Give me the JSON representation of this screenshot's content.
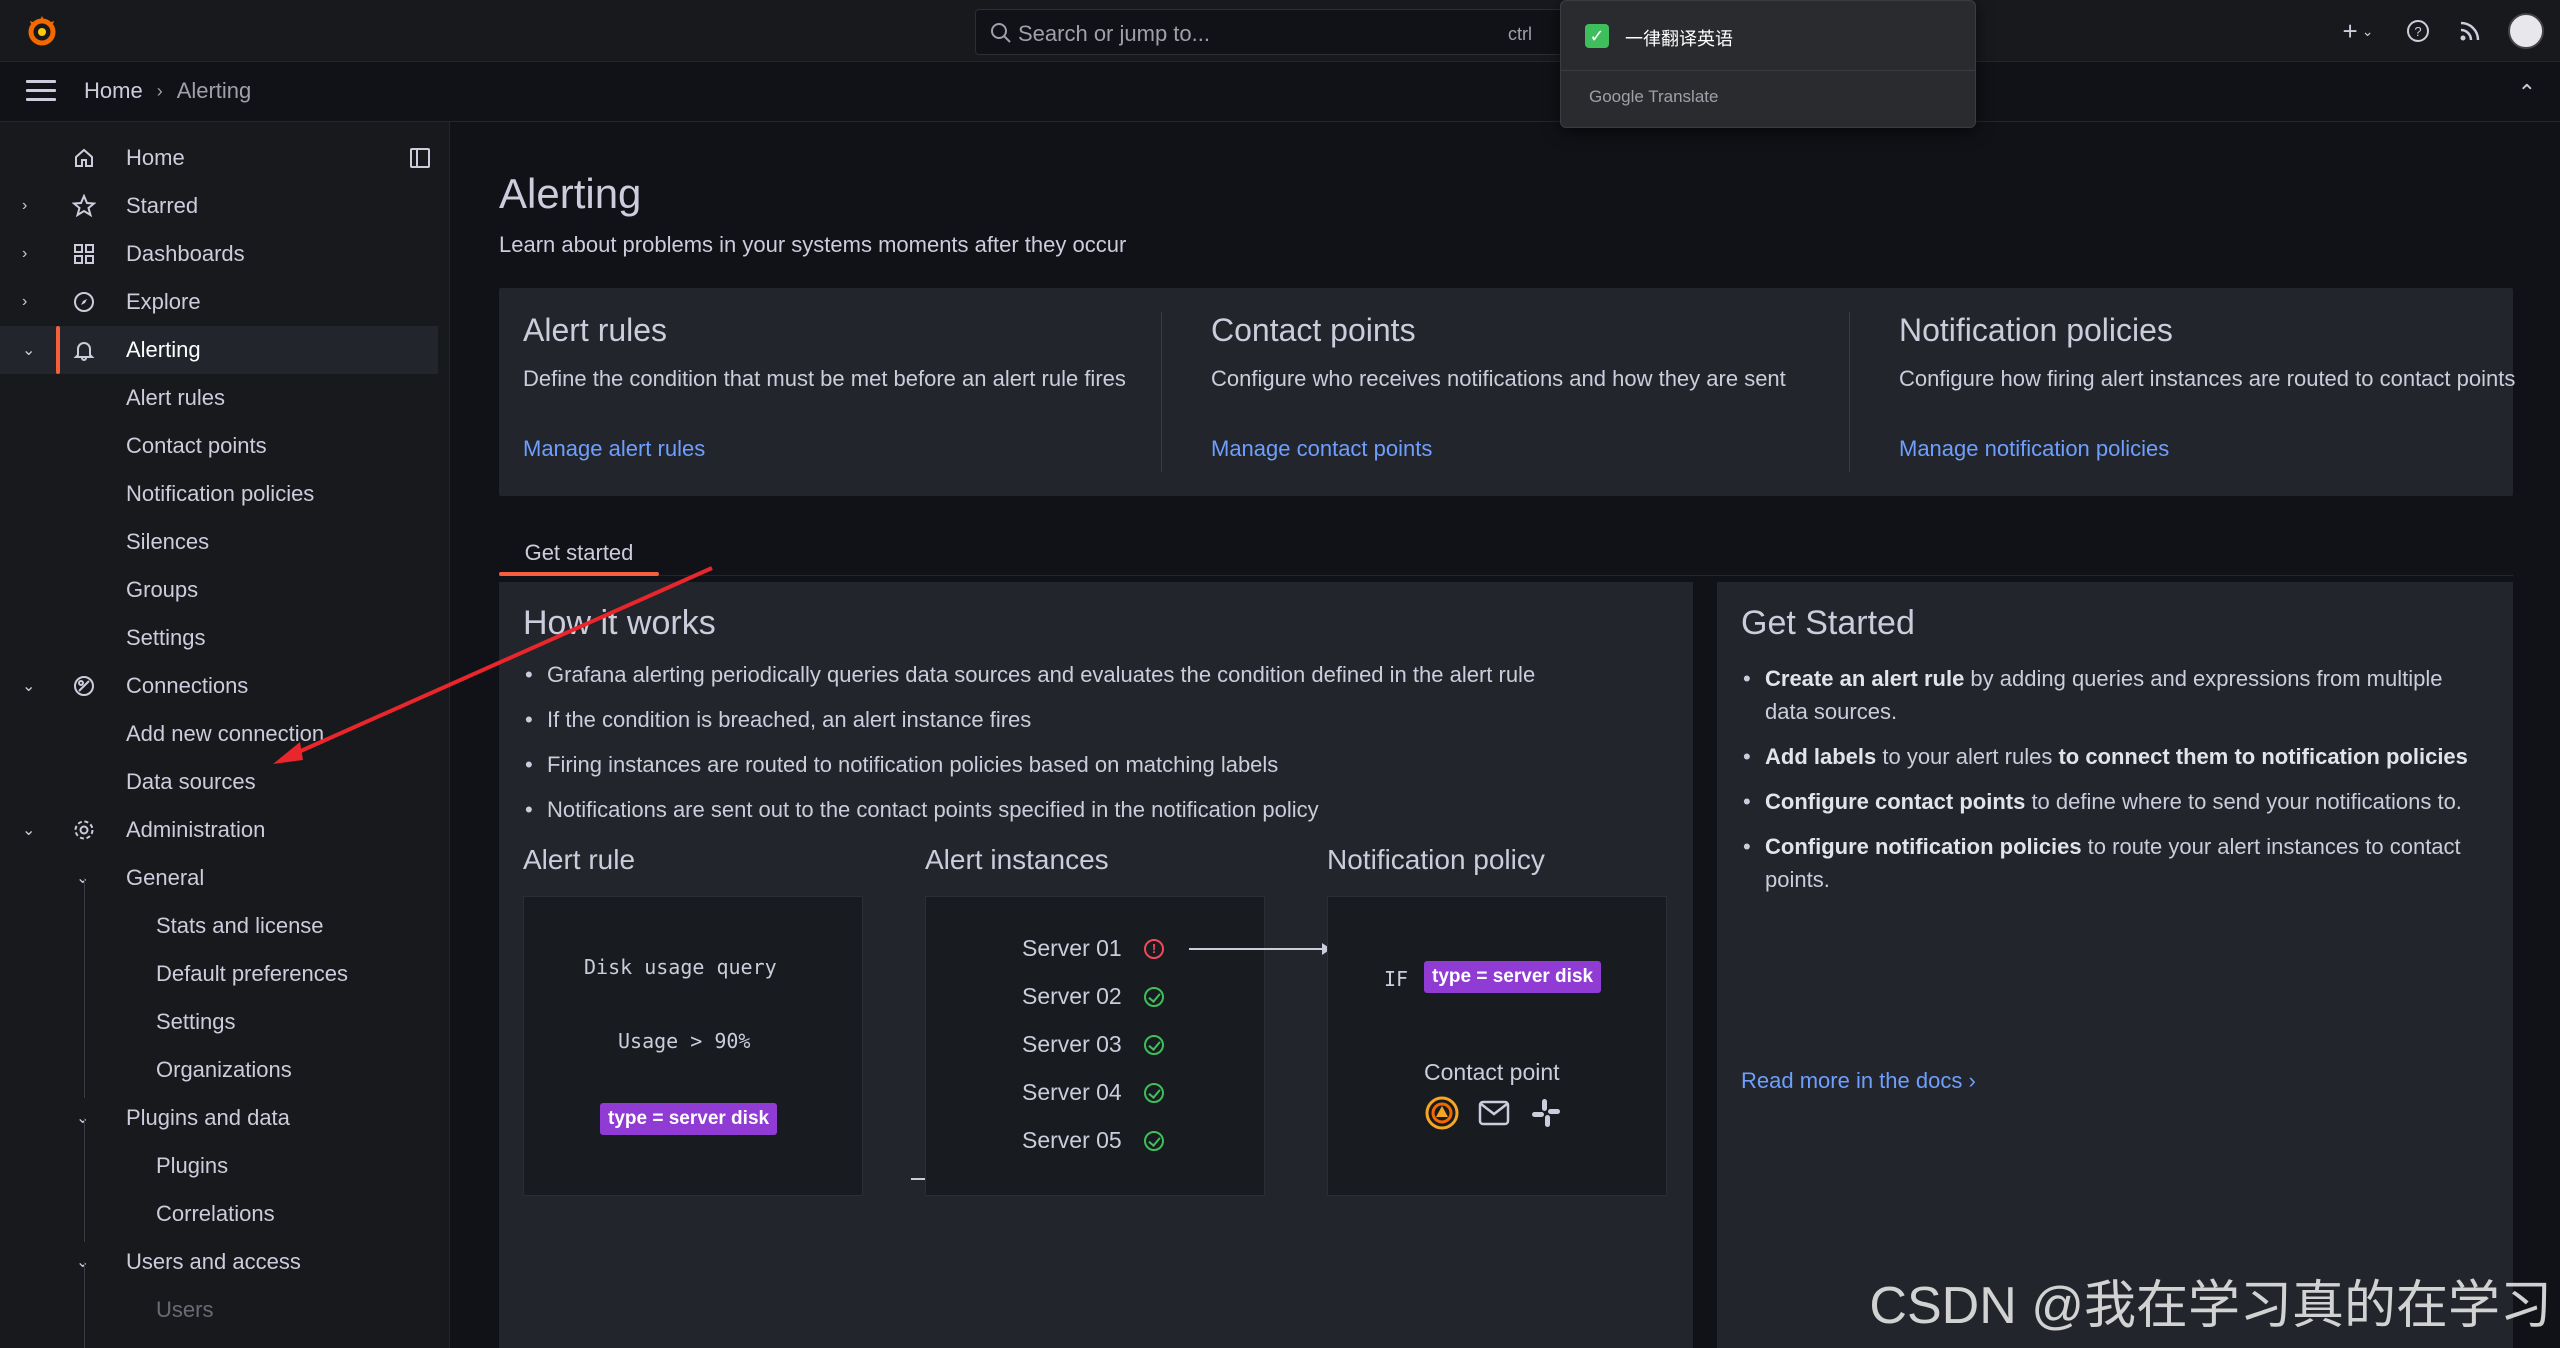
{
  "search": {
    "placeholder": "Search or jump to...",
    "shortcut": "ctrl"
  },
  "translate_popup": {
    "checkbox_label": "一律翻译英语",
    "brand": "Google Translate"
  },
  "breadcrumb": {
    "home": "Home",
    "current": "Alerting"
  },
  "sidebar": {
    "items": [
      {
        "label": "Home"
      },
      {
        "label": "Starred"
      },
      {
        "label": "Dashboards"
      },
      {
        "label": "Explore"
      },
      {
        "label": "Alerting"
      },
      {
        "label": "Alert rules"
      },
      {
        "label": "Contact points"
      },
      {
        "label": "Notification policies"
      },
      {
        "label": "Silences"
      },
      {
        "label": "Groups"
      },
      {
        "label": "Settings"
      },
      {
        "label": "Connections"
      },
      {
        "label": "Add new connection"
      },
      {
        "label": "Data sources"
      },
      {
        "label": "Administration"
      },
      {
        "label": "General"
      },
      {
        "label": "Stats and license"
      },
      {
        "label": "Default preferences"
      },
      {
        "label": "Settings"
      },
      {
        "label": "Organizations"
      },
      {
        "label": "Plugins and data"
      },
      {
        "label": "Plugins"
      },
      {
        "label": "Correlations"
      },
      {
        "label": "Users and access"
      },
      {
        "label": "Users"
      }
    ]
  },
  "page": {
    "title": "Alerting",
    "subtitle": "Learn about problems in your systems moments after they occur"
  },
  "overview": [
    {
      "title": "Alert rules",
      "desc": "Define the condition that must be met before an alert rule fires",
      "link": "Manage alert rules"
    },
    {
      "title": "Contact points",
      "desc": "Configure who receives notifications and how they are sent",
      "link": "Manage contact points"
    },
    {
      "title": "Notification policies",
      "desc": "Configure how firing alert instances are routed to contact points",
      "link": "Manage notification policies"
    }
  ],
  "tabs": {
    "get_started": "Get started"
  },
  "how": {
    "title": "How it works",
    "bullets": [
      "Grafana alerting periodically queries data sources and evaluates the condition defined in the alert rule",
      "If the condition is breached, an alert instance fires",
      "Firing instances are routed to notification policies based on matching labels",
      "Notifications are sent out to the contact points specified in the notification policy"
    ],
    "col_rule": "Alert rule",
    "col_instances": "Alert instances",
    "col_policy": "Notification policy",
    "query": "Disk usage query",
    "condition": "Usage > 90%",
    "tag_label": "type  = server disk",
    "servers": [
      "Server 01",
      "Server 02",
      "Server 03",
      "Server 04",
      "Server 05"
    ],
    "if_label": "IF",
    "contact_point": "Contact point"
  },
  "get_started": {
    "title": "Get Started",
    "items": [
      {
        "bold": "Create an alert rule",
        "rest": " by adding queries and expressions from multiple data sources."
      },
      {
        "bold": "Add labels",
        "rest": " to your alert rules ",
        "bold2": "to connect them to notification policies"
      },
      {
        "bold": "Configure contact points",
        "rest": " to define where to send your notifications to."
      },
      {
        "bold": "Configure notification policies",
        "rest": " to route your alert instances to contact points."
      }
    ],
    "docs_link": "Read more in the docs"
  },
  "watermark": "CSDN @我在学习真的在学习",
  "colors": {
    "accent": "#f55f3e",
    "link": "#6e9fff",
    "tag": "#8f3bd4",
    "ok": "#3fbf5c",
    "error": "#f2495c"
  }
}
